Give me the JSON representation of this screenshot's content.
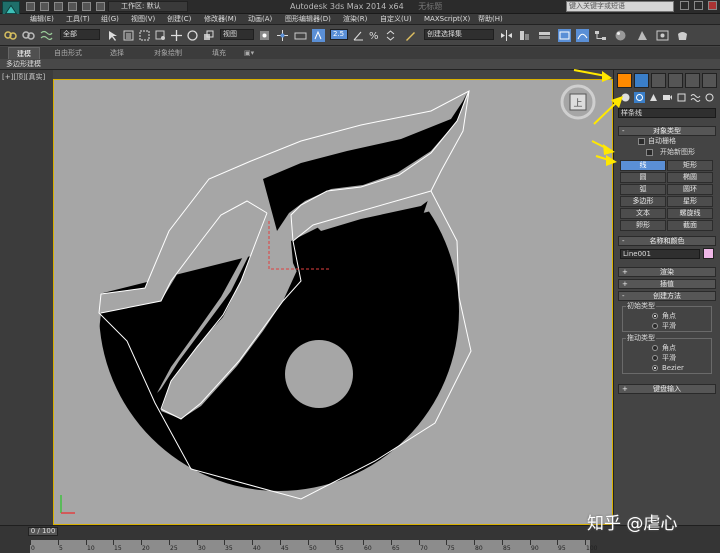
{
  "titlebar": {
    "workspace_label": "工作区: 默认",
    "app_title": "Autodesk 3ds Max  2014 x64",
    "document_tab": "无标题",
    "search_placeholder": "键入关键字或短语"
  },
  "menubar": {
    "items": [
      "编辑(E)",
      "工具(T)",
      "组(G)",
      "视图(V)",
      "创建(C)",
      "修改器(M)",
      "动画(A)",
      "图形编辑器(D)",
      "渲染(R)",
      "自定义(U)",
      "MAXScript(X)",
      "帮助(H)"
    ]
  },
  "toolbar": {
    "selection_filter": "全部",
    "reference_coord": "视图",
    "snap_value": "2.5",
    "named_selection": "创建选择集"
  },
  "ribbon": {
    "tabs": [
      "建模",
      "自由形式",
      "选择",
      "对象绘制",
      "填充"
    ],
    "sub_label": "多边形建模"
  },
  "viewport": {
    "label": "[+][顶][真实]",
    "viewcube_face": "上"
  },
  "command_panel": {
    "category": "样条线",
    "object_type": {
      "header": "对象类型",
      "autogrid": "自动栅格",
      "start_new_shape": "开始新图形",
      "buttons": [
        "线",
        "矩形",
        "圆",
        "椭圆",
        "弧",
        "圆环",
        "多边形",
        "星形",
        "文本",
        "螺旋线",
        "卵形",
        "截面"
      ]
    },
    "name_color": {
      "header": "名称和颜色",
      "name": "Line001",
      "color": "#f0b8e8"
    },
    "rollouts": [
      "渲染",
      "插值"
    ],
    "creation_method": {
      "header": "创建方法",
      "initial_type_label": "初始类型",
      "initial_options": [
        "角点",
        "平滑"
      ],
      "initial_selected": 0,
      "drag_type_label": "拖动类型",
      "drag_options": [
        "角点",
        "平滑",
        "Bezier"
      ],
      "drag_selected": 2
    },
    "keyboard_entry": "键盘输入"
  },
  "timeline": {
    "frame_display": "0 / 100",
    "ticks": [
      "0",
      "5",
      "10",
      "15",
      "20",
      "25",
      "30",
      "35",
      "40",
      "45",
      "50",
      "55",
      "60",
      "65",
      "70",
      "75",
      "80",
      "85",
      "90",
      "95",
      "100"
    ]
  },
  "watermark": "知乎 @虐心",
  "colors": {
    "active_button": "#5a8fd6",
    "arrow": "#ffe800",
    "viewport_bg": "#a6a6a6",
    "spline": "#ffffff"
  }
}
